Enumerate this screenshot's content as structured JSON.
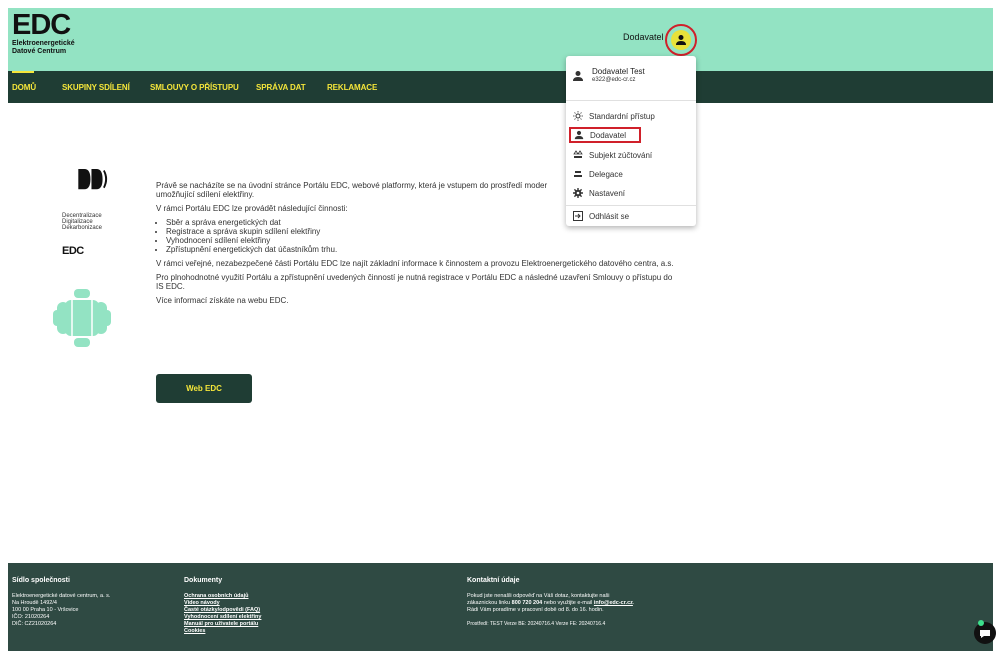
{
  "header": {
    "logo_mark": "EDC",
    "logo_sub1": "Elektroenergetické",
    "logo_sub2": "Datové Centrum",
    "user_role": "Dodavatel"
  },
  "nav": {
    "items": [
      "DOMŮ",
      "SKUPINY SDÍLENÍ",
      "SMLOUVY O PŘÍSTUPU",
      "SPRÁVA DAT",
      "REKLAMACE"
    ],
    "accent": "#f5e63a",
    "bg": "#1f3d34"
  },
  "side": {
    "ddd_mark": "D",
    "ddd_lines": [
      "Decentralizace",
      "Digitalizace",
      "Dekarbonizace"
    ],
    "edc_small": "EDC"
  },
  "main": {
    "p1": "Právě se nacházíte se na úvodní stránce Portálu EDC, webové platformy, která je vstupem do prostředí moder",
    "p1b": "umožňující sdílení elektřiny.",
    "p2": "V rámci Portálu EDC lze provádět následující činnosti:",
    "list": [
      "Sběr a správa energetických dat",
      "Registrace a správa skupin sdílení elektřiny",
      "Vyhodnocení sdílení elektřiny",
      "Zpřístupnění energetických dat účastníkům trhu."
    ],
    "p3": "V rámci veřejné, nezabezpečené části Portálu EDC lze najít základní informace k činnostem a provozu Elektroenergetického datového centra, a.s.",
    "p4": "Pro plnohodnotné využití Portálu a zpřístupnění uvedených činností je nutná registrace v Portálu EDC a následné uzavření Smlouvy o přístupu do IS EDC.",
    "p5": "Více informací získáte na webu EDC.",
    "button": "Web EDC"
  },
  "menu": {
    "name": "Dodavatel Test",
    "email": "e322@edc-cr.cz",
    "items": [
      "Standardní přístup",
      "Dodavatel",
      "Subjekt zúčtování",
      "Delegace",
      "Nastavení"
    ],
    "logout": "Odhlásit se"
  },
  "footer": {
    "col1_title": "Sídlo společnosti",
    "col1_lines": [
      "Elektroenergetické datové centrum, a. s.",
      "Na Hroudě 1492/4",
      "100 00 Praha 10 - Vršovice",
      "IČO: 21020264",
      "DIČ: CZ21020264"
    ],
    "col2_title": "Dokumenty",
    "col2_links": [
      "Ochrana osobních údajů",
      "Video návody",
      "Časté otázky/odpovědi (FAQ)",
      "Vyhodnocení sdílení elektřiny",
      "Manuál pro uživatele portálu",
      "Cookies"
    ],
    "col3_title": "Kontaktní údaje",
    "col3_line1": "Pokud jste nenašli odpověď na Váš dotaz, kontaktujte naši",
    "col3_line2a": "zákaznickou linku ",
    "col3_phone": "800 720 204",
    "col3_line2b": " nebo využijte e-mail ",
    "col3_email": "info@edc-cr.cz",
    "col3_line2c": ".",
    "col3_line3": "Rádi Vám poradíme v pracovní době od 8. do 16. hodin.",
    "col3_version": "Prostředí: TEST     Verze BE: 20240716.4     Verze FE: 20240716.4"
  }
}
